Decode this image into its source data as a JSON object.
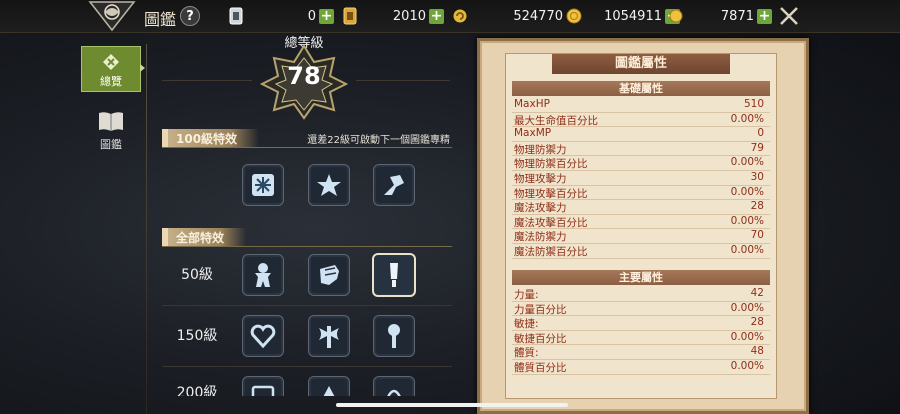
{
  "header": {
    "title": "圖鑑",
    "help_label": "?",
    "resources": [
      {
        "icon": "card-icon",
        "value": "0"
      },
      {
        "icon": "coupon-icon",
        "value": "2010"
      },
      {
        "icon": "refresh-coin-icon",
        "value": "524770"
      },
      {
        "icon": "gold-coin-icon",
        "value": "1054911"
      },
      {
        "icon": "small-gold-icon",
        "value": "7871"
      }
    ],
    "plus_label": "+"
  },
  "sidebar": {
    "items": [
      {
        "label": "總覽",
        "icon": "overview-icon",
        "selected": true
      },
      {
        "label": "圖鑑",
        "icon": "book-icon",
        "selected": false
      }
    ]
  },
  "level": {
    "label": "總等級",
    "value": "78"
  },
  "sections": {
    "lv100": {
      "title": "100級特效",
      "hint": "還差22級可啟動下一個圖鑑專精"
    },
    "all": {
      "title": "全部特效"
    }
  },
  "effect_rows": [
    {
      "label": "",
      "icons": [
        "snowflake-icon",
        "star-icon",
        "dragon-icon"
      ]
    },
    {
      "label": "50級",
      "icons": [
        "gingerbread-icon",
        "fist-icon",
        "sword-icon"
      ]
    },
    {
      "label": "150級",
      "icons": [
        "heart-icon",
        "axe-icon",
        "mace-icon"
      ]
    },
    {
      "label": "200級",
      "icons": [
        "shield-icon",
        "triangle-icon",
        "staff-icon"
      ]
    }
  ],
  "panel": {
    "title": "圖鑑屬性",
    "basic_header": "基礎屬性",
    "basic": [
      {
        "name": "MaxHP",
        "value": "510"
      },
      {
        "name": "最大生命值百分比",
        "value": "0.00%"
      },
      {
        "name": "MaxMP",
        "value": "0"
      },
      {
        "name": "物理防禦力",
        "value": "79"
      },
      {
        "name": "物理防禦百分比",
        "value": "0.00%"
      },
      {
        "name": "物理攻擊力",
        "value": "30"
      },
      {
        "name": "物理攻擊百分比",
        "value": "0.00%"
      },
      {
        "name": "魔法攻擊力",
        "value": "28"
      },
      {
        "name": "魔法攻擊百分比",
        "value": "0.00%"
      },
      {
        "name": "魔法防禦力",
        "value": "70"
      },
      {
        "name": "魔法防禦百分比",
        "value": "0.00%"
      }
    ],
    "main_header": "主要屬性",
    "main": [
      {
        "name": "力量:",
        "value": "42"
      },
      {
        "name": "力量百分比",
        "value": "0.00%"
      },
      {
        "name": "敏捷:",
        "value": "28"
      },
      {
        "name": "敏捷百分比",
        "value": "0.00%"
      },
      {
        "name": "體質:",
        "value": "48"
      },
      {
        "name": "體質百分比",
        "value": "0.00%"
      }
    ]
  },
  "colors": {
    "accent_green": "#6f8b2f",
    "plus_green": "#6fa63a",
    "stat_text": "#8f2e18",
    "parchment": "#f1e4cc"
  }
}
